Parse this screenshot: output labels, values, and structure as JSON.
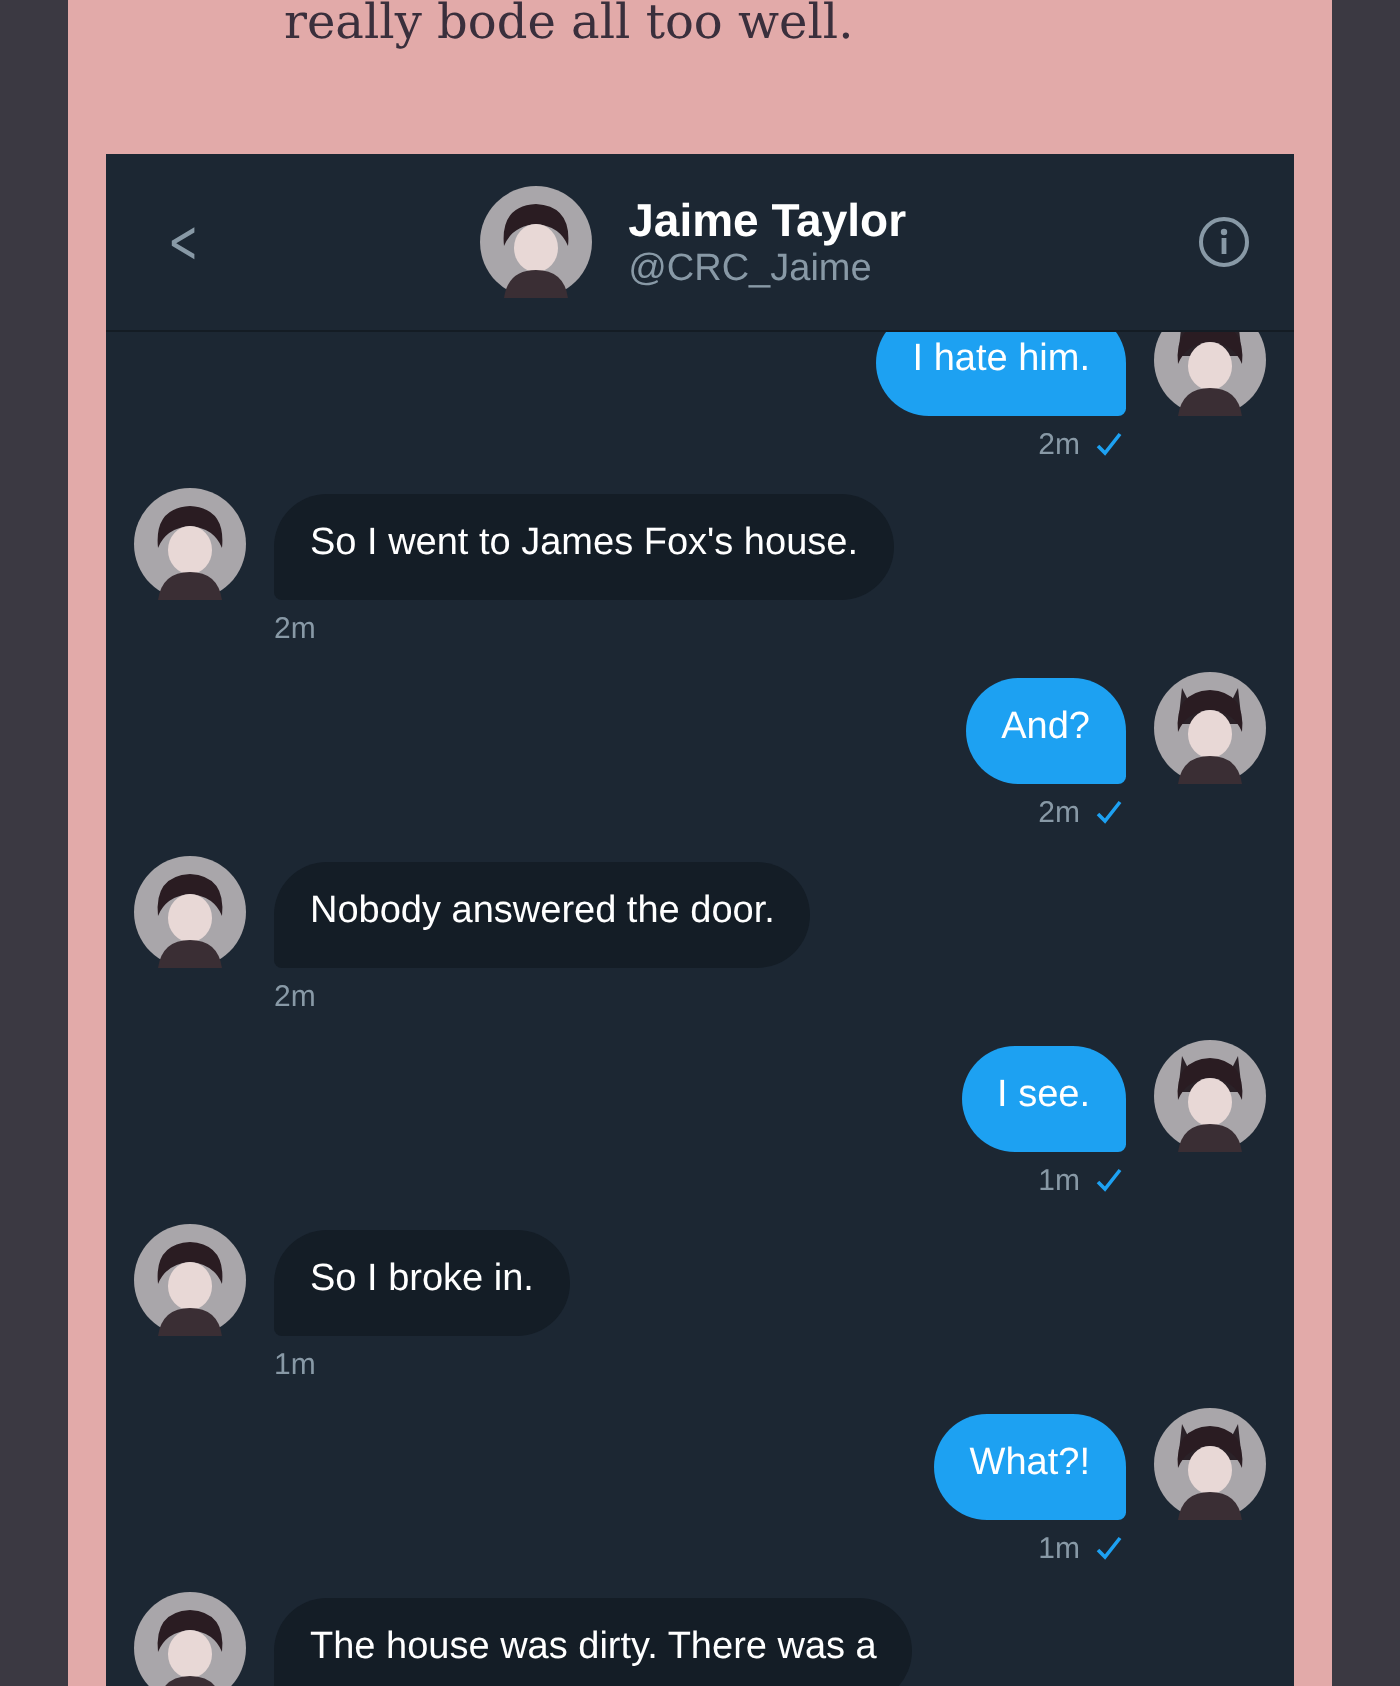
{
  "intro_text": "really bode all too well.",
  "chat": {
    "back": "<",
    "name": "Jaime Taylor",
    "handle": "@CRC_Jaime",
    "messages": [
      {
        "kind": "outgoing",
        "text": "I hate him.",
        "time": "2m",
        "read": true
      },
      {
        "kind": "incoming",
        "text": "So I went to James Fox's house.",
        "time": "2m"
      },
      {
        "kind": "outgoing",
        "text": "And?",
        "time": "2m",
        "read": true
      },
      {
        "kind": "incoming",
        "text": "Nobody answered the door.",
        "time": "2m"
      },
      {
        "kind": "outgoing",
        "text": "I see.",
        "time": "1m",
        "read": true
      },
      {
        "kind": "incoming",
        "text": "So I broke in.",
        "time": "1m"
      },
      {
        "kind": "outgoing",
        "text": "What?!",
        "time": "1m",
        "read": true
      },
      {
        "kind": "incoming",
        "text": "The house was dirty. There was a"
      }
    ]
  }
}
